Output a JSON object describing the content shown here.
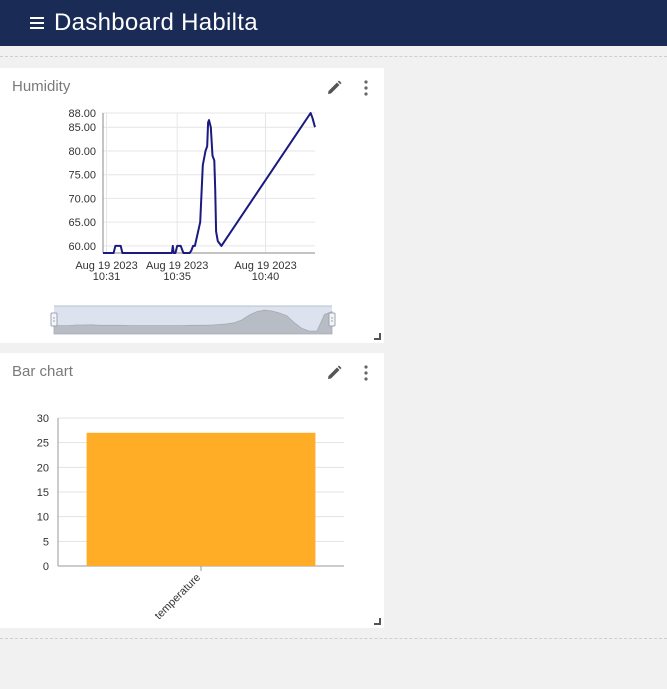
{
  "app": {
    "title": "Dashboard Habilta"
  },
  "widgets": {
    "humidity": {
      "title": "Humidity"
    },
    "bar": {
      "title": "Bar chart"
    }
  },
  "icons": {
    "menu": "hamburger-menu-icon",
    "edit": "pencil-icon",
    "more": "kebab-menu-icon"
  },
  "colors": {
    "topbar": "#1a2b56",
    "line": "#1a1a80",
    "bar": "#ffad26"
  },
  "chart_data": [
    {
      "type": "line",
      "title": "Humidity",
      "x_ticks": [
        {
          "x": 0.0,
          "line1": "Aug 19 2023",
          "line2": "10:31"
        },
        {
          "x": 4.0,
          "line1": "Aug 19 2023",
          "line2": "10:35"
        },
        {
          "x": 9.0,
          "line1": "Aug 19 2023",
          "line2": "10:40"
        }
      ],
      "y_ticks": [
        "60.00",
        "65.00",
        "70.00",
        "75.00",
        "80.00",
        "85.00",
        "88.00"
      ],
      "xlim": [
        -0.2,
        11.8
      ],
      "ylim": [
        58.5,
        88
      ],
      "series": [
        {
          "x": [
            -0.2,
            0.4,
            0.5,
            0.8,
            0.9,
            3.7,
            3.75,
            3.8,
            3.9,
            4.0,
            4.1,
            4.2,
            4.35,
            4.5,
            4.7,
            4.8,
            4.9,
            5.0,
            5.3,
            5.45,
            5.6,
            5.7,
            5.75,
            5.8,
            5.9,
            6.0,
            6.1,
            6.15,
            6.2,
            6.3,
            6.5,
            11.55,
            11.65,
            11.8
          ],
          "y": [
            58.5,
            58.5,
            60,
            60,
            58.5,
            58.5,
            60,
            58.5,
            58.5,
            60,
            60,
            60,
            58.5,
            58.5,
            58.5,
            59,
            60,
            60,
            65,
            77,
            80,
            81,
            86,
            86.5,
            85,
            79,
            78,
            72,
            63,
            61,
            60,
            88,
            87,
            85
          ]
        }
      ],
      "navigator": {
        "y": [
          3,
          3,
          3,
          3.2,
          3.2,
          3.3,
          3.1,
          3.1,
          3.1,
          3.1,
          3,
          3,
          3,
          3,
          3,
          3,
          3,
          3,
          3.1,
          3.1,
          3.1,
          3.2,
          3.4,
          3.6,
          4,
          5,
          6.8,
          8,
          8.5,
          8.2,
          7.5,
          6.5,
          4,
          2,
          1,
          1,
          7,
          8
        ]
      },
      "grid": true
    },
    {
      "type": "bar",
      "title": "Bar chart",
      "categories": [
        "temperature"
      ],
      "values": [
        27
      ],
      "ylim": [
        0,
        30
      ],
      "y_ticks": [
        "0",
        "5",
        "10",
        "15",
        "20",
        "25",
        "30"
      ],
      "grid": true
    }
  ]
}
